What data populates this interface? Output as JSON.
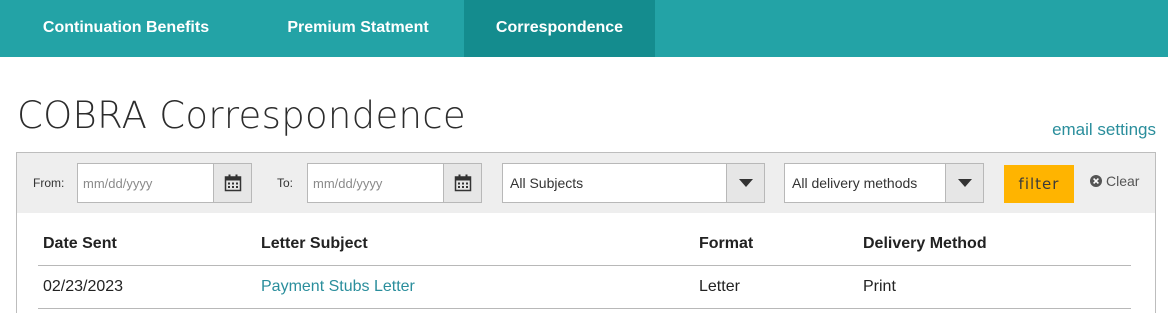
{
  "tabs": [
    {
      "label": "Continuation Benefits",
      "active": false
    },
    {
      "label": "Premium Statment",
      "active": false
    },
    {
      "label": "Correspondence",
      "active": true
    }
  ],
  "page": {
    "title": "COBRA Correspondence",
    "email_settings_link": "email settings"
  },
  "filters": {
    "from_label": "From:",
    "from_placeholder": "mm/dd/yyyy",
    "to_label": "To:",
    "to_placeholder": "mm/dd/yyyy",
    "subject_select": "All Subjects",
    "delivery_select": "All delivery methods",
    "filter_button": "filter",
    "clear_label": "Clear"
  },
  "table": {
    "columns": [
      "Date Sent",
      "Letter Subject",
      "Format",
      "Delivery Method"
    ],
    "rows": [
      {
        "date_sent": "02/23/2023",
        "letter_subject": "Payment Stubs Letter",
        "format": "Letter",
        "delivery_method": "Print"
      }
    ]
  },
  "colors": {
    "tab_bar": "#23a3a6",
    "tab_active": "#148c8e",
    "link": "#2a8e9c",
    "filter_button": "#ffb400"
  }
}
